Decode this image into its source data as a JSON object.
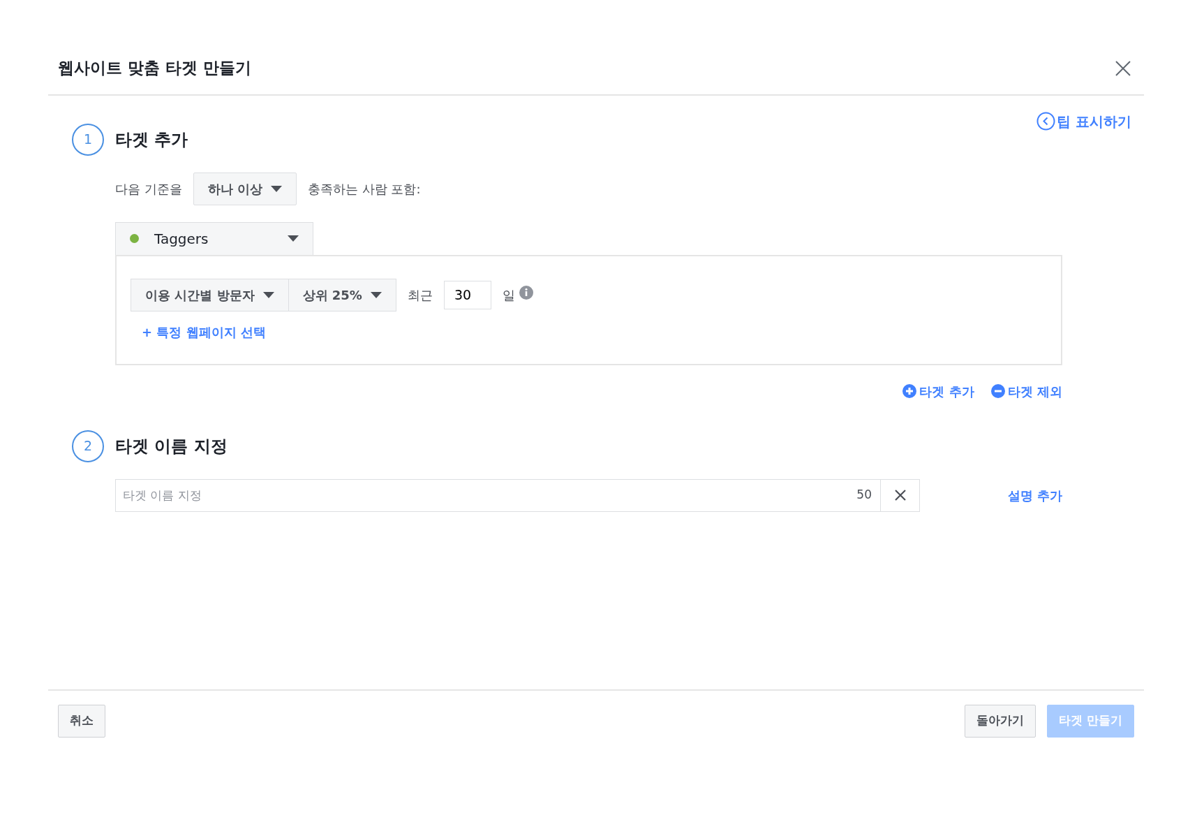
{
  "dialog": {
    "title": "웹사이트 맞춤 타겟 만들기",
    "tip_link": "팁 표시하기"
  },
  "step1": {
    "number": "1",
    "heading": "타겟 추가",
    "prefix": "다음 기준을",
    "match_dropdown": "하나 이상",
    "suffix": "충족하는 사람 포함:",
    "source": {
      "label": "Taggers",
      "color": "#7cb342"
    },
    "rule": {
      "event_dropdown": "이용 시간별 방문자",
      "percentile_dropdown": "상위 25%",
      "recent_label": "최근",
      "days_value": "30",
      "days_unit": "일",
      "add_pages_link": "+ 특정 웹페이지 선택"
    },
    "actions": [
      {
        "kind": "include",
        "label": "타겟 추가"
      },
      {
        "kind": "exclude",
        "label": "타겟 제외"
      }
    ]
  },
  "step2": {
    "number": "2",
    "heading": "타겟 이름 지정",
    "name_field": {
      "placeholder": "타겟 이름 지정",
      "char_count": "50"
    },
    "description_link": "설명 추가"
  },
  "footer": {
    "buttons": [
      {
        "kind": "cancel",
        "label": "취소",
        "disabled": false
      },
      {
        "kind": "back",
        "label": "돌아가기",
        "disabled": false
      },
      {
        "kind": "primary",
        "label": "타겟 만들기",
        "disabled": true
      }
    ]
  }
}
